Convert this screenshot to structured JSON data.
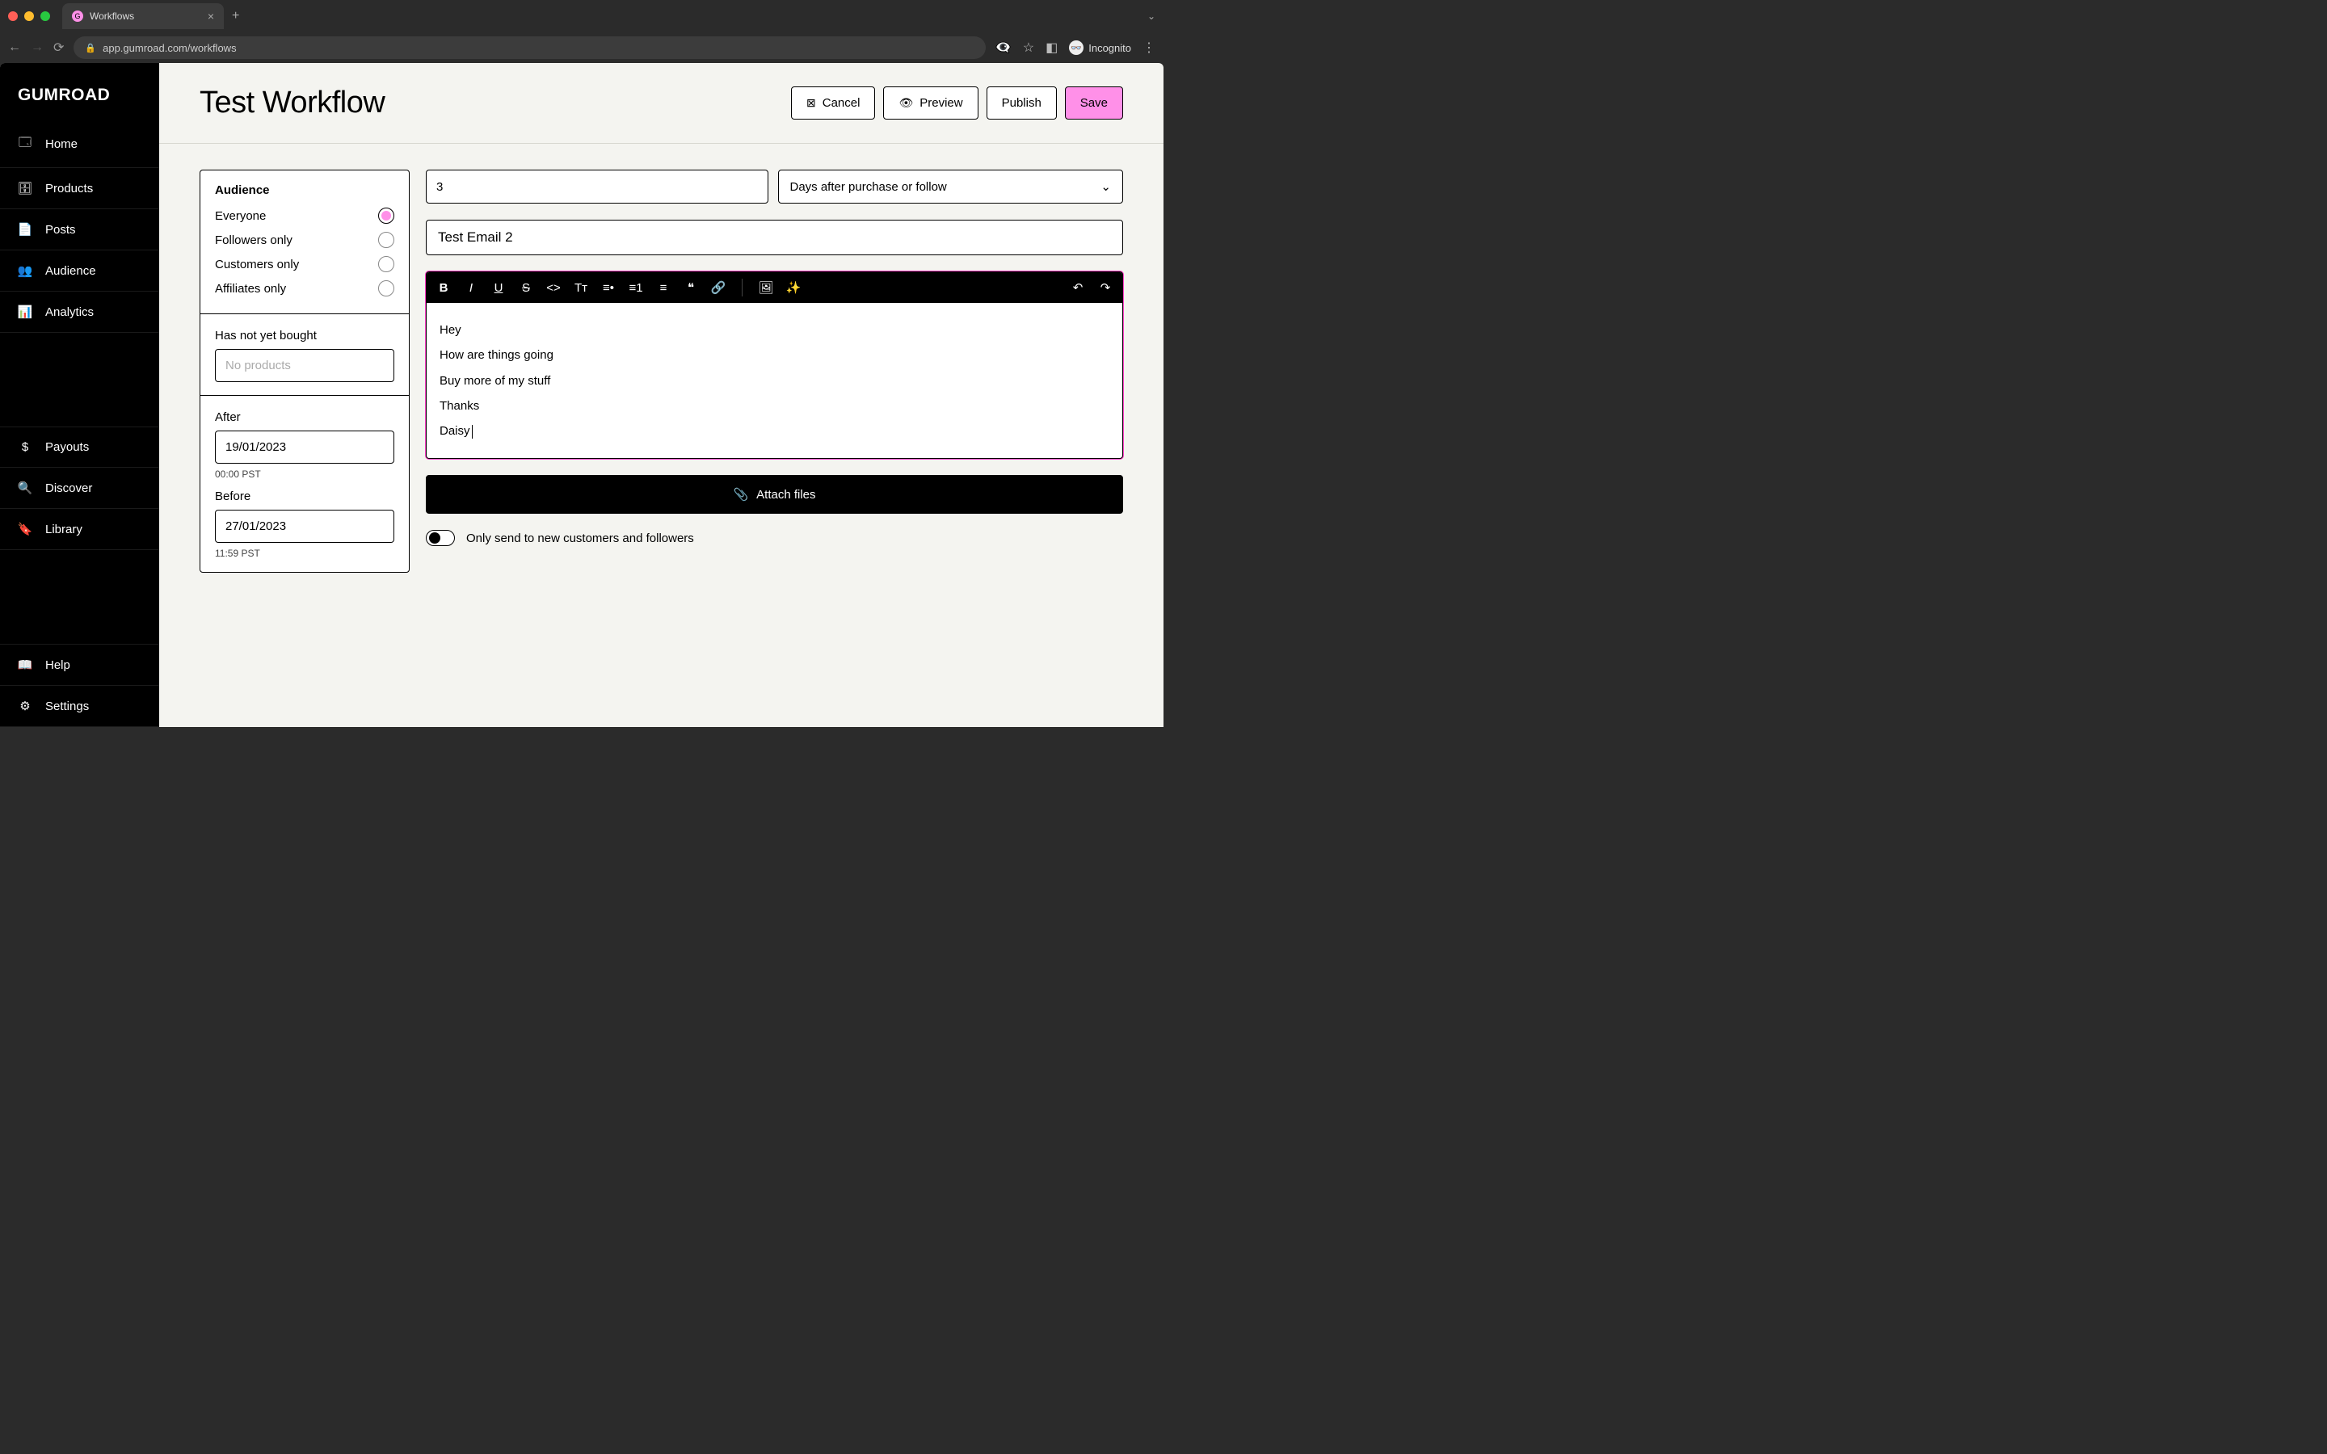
{
  "browser": {
    "tab_title": "Workflows",
    "url": "app.gumroad.com/workflows",
    "incognito_label": "Incognito"
  },
  "brand": {
    "logo_text": "GUMROAD"
  },
  "sidebar": {
    "items": [
      {
        "label": "Home"
      },
      {
        "label": "Products"
      },
      {
        "label": "Posts"
      },
      {
        "label": "Audience"
      },
      {
        "label": "Analytics"
      }
    ],
    "secondary": [
      {
        "label": "Payouts"
      },
      {
        "label": "Discover"
      },
      {
        "label": "Library"
      }
    ],
    "footer": [
      {
        "label": "Help"
      },
      {
        "label": "Settings"
      }
    ]
  },
  "header": {
    "title": "Test Workflow",
    "cancel": "Cancel",
    "preview": "Preview",
    "publish": "Publish",
    "save": "Save"
  },
  "audience": {
    "heading": "Audience",
    "options": [
      {
        "label": "Everyone",
        "selected": true
      },
      {
        "label": "Followers only",
        "selected": false
      },
      {
        "label": "Customers only",
        "selected": false
      },
      {
        "label": "Affiliates only",
        "selected": false
      }
    ],
    "not_bought_label": "Has not yet bought",
    "not_bought_placeholder": "No products",
    "after_label": "After",
    "after_value": "19/01/2023",
    "after_sub": "00:00 PST",
    "before_label": "Before",
    "before_value": "27/01/2023",
    "before_sub": "11:59 PST"
  },
  "email": {
    "delay_value": "3",
    "trigger_label": "Days after purchase or follow",
    "subject": "Test Email 2",
    "body": [
      "Hey",
      "How are things going",
      "Buy more of my stuff",
      "Thanks",
      "Daisy"
    ],
    "attach_label": "Attach files",
    "toggle_label": "Only send to new customers and followers"
  },
  "colors": {
    "accent": "#ff90e8"
  }
}
